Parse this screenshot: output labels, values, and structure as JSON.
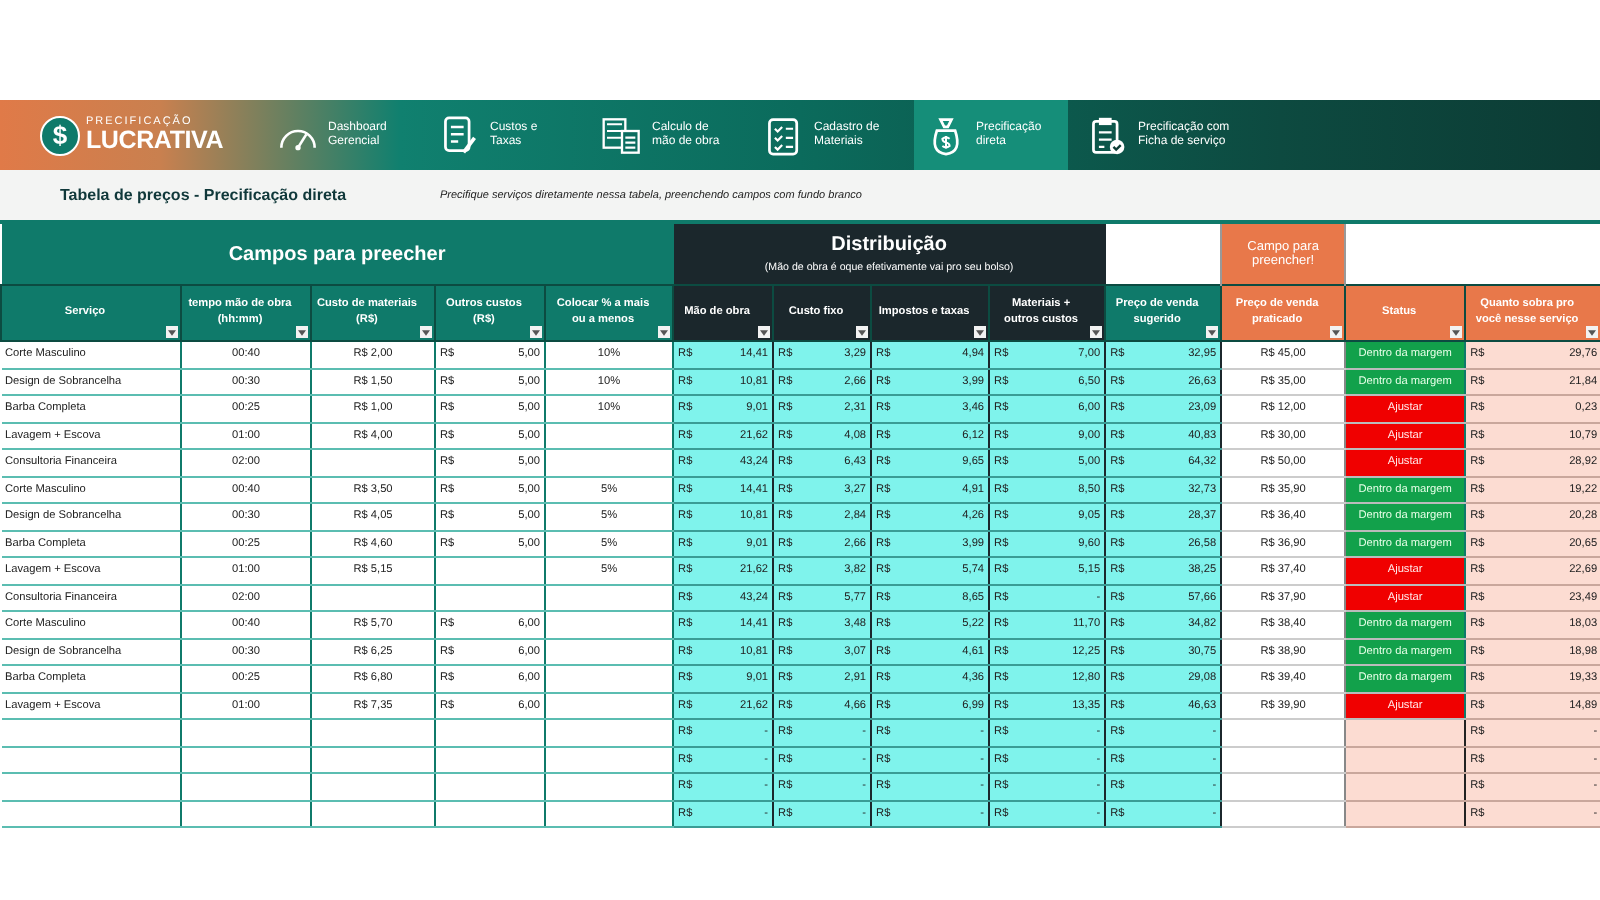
{
  "brand": {
    "tagline": "PRECIFICAÇÃO",
    "name": "LUCRATIVA",
    "symbol": "$"
  },
  "nav": [
    {
      "label": "Dashboard Gerencial",
      "kind": "gauge",
      "selected": false
    },
    {
      "label": "Custos e Taxas",
      "kind": "doc",
      "selected": false
    },
    {
      "label": "Calculo de mão de obra",
      "kind": "calc",
      "selected": false
    },
    {
      "label": "Cadastro de Materiais",
      "kind": "list",
      "selected": false
    },
    {
      "label": "Precificação direta",
      "kind": "bag",
      "selected": true
    },
    {
      "label": "Precificação com Ficha de serviço",
      "kind": "clip",
      "selected": false
    }
  ],
  "page": {
    "title": "Tabela de preços - Precificação direta",
    "note": "Precifique serviços diretamente nessa tabela, preenchendo campos com fundo branco"
  },
  "groups": [
    {
      "kind": "input",
      "title": "Campos para preecher"
    },
    {
      "kind": "distribution",
      "title": "Distribuição",
      "subtitle": "(Mão de obra é oque efetivamente vai pro seu bolso)"
    },
    {
      "kind": "blank"
    },
    {
      "kind": "practiced",
      "title": "Campo para preencher!"
    },
    {
      "kind": "blank"
    }
  ],
  "columns": [
    {
      "label": "Serviço",
      "kind": "input"
    },
    {
      "label": "tempo mão de obra (hh:mm)",
      "kind": "input"
    },
    {
      "label": "Custo de materiais (R$)",
      "kind": "input"
    },
    {
      "label": "Outros custos (R$)",
      "kind": "input"
    },
    {
      "label": "Colocar % a mais ou a menos",
      "kind": "input"
    },
    {
      "label": "Mão de obra",
      "kind": "distribution"
    },
    {
      "label": "Custo fixo",
      "kind": "distribution"
    },
    {
      "label": "Impostos e taxas",
      "kind": "distribution"
    },
    {
      "label": "Materiais + outros custos",
      "kind": "distribution"
    },
    {
      "label": "Preço de venda sugerido",
      "kind": "suggested"
    },
    {
      "label": "Preço de venda praticado",
      "kind": "practiced"
    },
    {
      "label": "Status",
      "kind": "practiced"
    },
    {
      "label": "Quanto sobra pro você nesse serviço",
      "kind": "practiced"
    }
  ],
  "rows": [
    {
      "service": "Corte Masculino",
      "time": "00:40",
      "materials": "R$ 2,00",
      "other": [
        "R$",
        "5,00"
      ],
      "percent": "10%",
      "labor": [
        "R$",
        "14,41"
      ],
      "fixed": [
        "R$",
        "3,29"
      ],
      "taxes": [
        "R$",
        "4,94"
      ],
      "materials_other": [
        "R$",
        "7,00"
      ],
      "suggested": [
        "R$",
        "32,95"
      ],
      "practiced": "R$ 45,00",
      "status": {
        "label": "Dentro da margem",
        "kind": "ok"
      },
      "leftover": [
        "R$",
        "29,76"
      ]
    },
    {
      "service": "Design de Sobrancelha",
      "time": "00:30",
      "materials": "R$ 1,50",
      "other": [
        "R$",
        "5,00"
      ],
      "percent": "10%",
      "labor": [
        "R$",
        "10,81"
      ],
      "fixed": [
        "R$",
        "2,66"
      ],
      "taxes": [
        "R$",
        "3,99"
      ],
      "materials_other": [
        "R$",
        "6,50"
      ],
      "suggested": [
        "R$",
        "26,63"
      ],
      "practiced": "R$ 35,00",
      "status": {
        "label": "Dentro da margem",
        "kind": "ok"
      },
      "leftover": [
        "R$",
        "21,84"
      ]
    },
    {
      "service": "Barba Completa",
      "time": "00:25",
      "materials": "R$ 1,00",
      "other": [
        "R$",
        "5,00"
      ],
      "percent": "10%",
      "labor": [
        "R$",
        "9,01"
      ],
      "fixed": [
        "R$",
        "2,31"
      ],
      "taxes": [
        "R$",
        "3,46"
      ],
      "materials_other": [
        "R$",
        "6,00"
      ],
      "suggested": [
        "R$",
        "23,09"
      ],
      "practiced": "R$ 12,00",
      "status": {
        "label": "Ajustar",
        "kind": "adjust"
      },
      "leftover": [
        "R$",
        "0,23"
      ]
    },
    {
      "service": "Lavagem + Escova",
      "time": "01:00",
      "materials": "R$ 4,00",
      "other": [
        "R$",
        "5,00"
      ],
      "labor": [
        "R$",
        "21,62"
      ],
      "fixed": [
        "R$",
        "4,08"
      ],
      "taxes": [
        "R$",
        "6,12"
      ],
      "materials_other": [
        "R$",
        "9,00"
      ],
      "suggested": [
        "R$",
        "40,83"
      ],
      "practiced": "R$ 30,00",
      "status": {
        "label": "Ajustar",
        "kind": "adjust"
      },
      "leftover": [
        "R$",
        "10,79"
      ]
    },
    {
      "service": "Consultoria Financeira",
      "time": "02:00",
      "other": [
        "R$",
        "5,00"
      ],
      "labor": [
        "R$",
        "43,24"
      ],
      "fixed": [
        "R$",
        "6,43"
      ],
      "taxes": [
        "R$",
        "9,65"
      ],
      "materials_other": [
        "R$",
        "5,00"
      ],
      "suggested": [
        "R$",
        "64,32"
      ],
      "practiced": "R$ 50,00",
      "status": {
        "label": "Ajustar",
        "kind": "adjust"
      },
      "leftover": [
        "R$",
        "28,92"
      ]
    },
    {
      "service": "Corte Masculino",
      "time": "00:40",
      "materials": "R$ 3,50",
      "other": [
        "R$",
        "5,00"
      ],
      "percent": "5%",
      "labor": [
        "R$",
        "14,41"
      ],
      "fixed": [
        "R$",
        "3,27"
      ],
      "taxes": [
        "R$",
        "4,91"
      ],
      "materials_other": [
        "R$",
        "8,50"
      ],
      "suggested": [
        "R$",
        "32,73"
      ],
      "practiced": "R$ 35,90",
      "status": {
        "label": "Dentro da margem",
        "kind": "ok"
      },
      "leftover": [
        "R$",
        "19,22"
      ]
    },
    {
      "service": "Design de Sobrancelha",
      "time": "00:30",
      "materials": "R$ 4,05",
      "other": [
        "R$",
        "5,00"
      ],
      "percent": "5%",
      "labor": [
        "R$",
        "10,81"
      ],
      "fixed": [
        "R$",
        "2,84"
      ],
      "taxes": [
        "R$",
        "4,26"
      ],
      "materials_other": [
        "R$",
        "9,05"
      ],
      "suggested": [
        "R$",
        "28,37"
      ],
      "practiced": "R$ 36,40",
      "status": {
        "label": "Dentro da margem",
        "kind": "ok"
      },
      "leftover": [
        "R$",
        "20,28"
      ]
    },
    {
      "service": "Barba Completa",
      "time": "00:25",
      "materials": "R$ 4,60",
      "other": [
        "R$",
        "5,00"
      ],
      "percent": "5%",
      "labor": [
        "R$",
        "9,01"
      ],
      "fixed": [
        "R$",
        "2,66"
      ],
      "taxes": [
        "R$",
        "3,99"
      ],
      "materials_other": [
        "R$",
        "9,60"
      ],
      "suggested": [
        "R$",
        "26,58"
      ],
      "practiced": "R$ 36,90",
      "status": {
        "label": "Dentro da margem",
        "kind": "ok"
      },
      "leftover": [
        "R$",
        "20,65"
      ]
    },
    {
      "service": "Lavagem + Escova",
      "time": "01:00",
      "materials": "R$ 5,15",
      "percent": "5%",
      "labor": [
        "R$",
        "21,62"
      ],
      "fixed": [
        "R$",
        "3,82"
      ],
      "taxes": [
        "R$",
        "5,74"
      ],
      "materials_other": [
        "R$",
        "5,15"
      ],
      "suggested": [
        "R$",
        "38,25"
      ],
      "practiced": "R$ 37,40",
      "status": {
        "label": "Ajustar",
        "kind": "adjust"
      },
      "leftover": [
        "R$",
        "22,69"
      ]
    },
    {
      "service": "Consultoria Financeira",
      "time": "02:00",
      "labor": [
        "R$",
        "43,24"
      ],
      "fixed": [
        "R$",
        "5,77"
      ],
      "taxes": [
        "R$",
        "8,65"
      ],
      "materials_other": [
        "R$",
        "-"
      ],
      "suggested": [
        "R$",
        "57,66"
      ],
      "practiced": "R$ 37,90",
      "status": {
        "label": "Ajustar",
        "kind": "adjust"
      },
      "leftover": [
        "R$",
        "23,49"
      ]
    },
    {
      "service": "Corte Masculino",
      "time": "00:40",
      "materials": "R$ 5,70",
      "other": [
        "R$",
        "6,00"
      ],
      "labor": [
        "R$",
        "14,41"
      ],
      "fixed": [
        "R$",
        "3,48"
      ],
      "taxes": [
        "R$",
        "5,22"
      ],
      "materials_other": [
        "R$",
        "11,70"
      ],
      "suggested": [
        "R$",
        "34,82"
      ],
      "practiced": "R$ 38,40",
      "status": {
        "label": "Dentro da margem",
        "kind": "ok"
      },
      "leftover": [
        "R$",
        "18,03"
      ]
    },
    {
      "service": "Design de Sobrancelha",
      "time": "00:30",
      "materials": "R$ 6,25",
      "other": [
        "R$",
        "6,00"
      ],
      "labor": [
        "R$",
        "10,81"
      ],
      "fixed": [
        "R$",
        "3,07"
      ],
      "taxes": [
        "R$",
        "4,61"
      ],
      "materials_other": [
        "R$",
        "12,25"
      ],
      "suggested": [
        "R$",
        "30,75"
      ],
      "practiced": "R$ 38,90",
      "status": {
        "label": "Dentro da margem",
        "kind": "ok"
      },
      "leftover": [
        "R$",
        "18,98"
      ]
    },
    {
      "service": "Barba Completa",
      "time": "00:25",
      "materials": "R$ 6,80",
      "other": [
        "R$",
        "6,00"
      ],
      "labor": [
        "R$",
        "9,01"
      ],
      "fixed": [
        "R$",
        "2,91"
      ],
      "taxes": [
        "R$",
        "4,36"
      ],
      "materials_other": [
        "R$",
        "12,80"
      ],
      "suggested": [
        "R$",
        "29,08"
      ],
      "practiced": "R$ 39,40",
      "status": {
        "label": "Dentro da margem",
        "kind": "ok"
      },
      "leftover": [
        "R$",
        "19,33"
      ]
    },
    {
      "service": "Lavagem + Escova",
      "time": "01:00",
      "materials": "R$ 7,35",
      "other": [
        "R$",
        "6,00"
      ],
      "labor": [
        "R$",
        "21,62"
      ],
      "fixed": [
        "R$",
        "4,66"
      ],
      "taxes": [
        "R$",
        "6,99"
      ],
      "materials_other": [
        "R$",
        "13,35"
      ],
      "suggested": [
        "R$",
        "46,63"
      ],
      "practiced": "R$ 39,90",
      "status": {
        "label": "Ajustar",
        "kind": "adjust"
      },
      "leftover": [
        "R$",
        "14,89"
      ]
    },
    {
      "labor": [
        "R$",
        "-"
      ],
      "fixed": [
        "R$",
        "-"
      ],
      "taxes": [
        "R$",
        "-"
      ],
      "materials_other": [
        "R$",
        "-"
      ],
      "suggested": [
        "R$",
        "-"
      ],
      "leftover": [
        "R$",
        "-"
      ]
    },
    {
      "labor": [
        "R$",
        "-"
      ],
      "fixed": [
        "R$",
        "-"
      ],
      "taxes": [
        "R$",
        "-"
      ],
      "materials_other": [
        "R$",
        "-"
      ],
      "suggested": [
        "R$",
        "-"
      ],
      "leftover": [
        "R$",
        "-"
      ]
    },
    {
      "labor": [
        "R$",
        "-"
      ],
      "fixed": [
        "R$",
        "-"
      ],
      "taxes": [
        "R$",
        "-"
      ],
      "materials_other": [
        "R$",
        "-"
      ],
      "suggested": [
        "R$",
        "-"
      ],
      "leftover": [
        "R$",
        "-"
      ]
    },
    {
      "labor": [
        "R$",
        "-"
      ],
      "fixed": [
        "R$",
        "-"
      ],
      "taxes": [
        "R$",
        "-"
      ],
      "materials_other": [
        "R$",
        "-"
      ],
      "suggested": [
        "R$",
        "-"
      ],
      "leftover": [
        "R$",
        "-"
      ]
    }
  ]
}
